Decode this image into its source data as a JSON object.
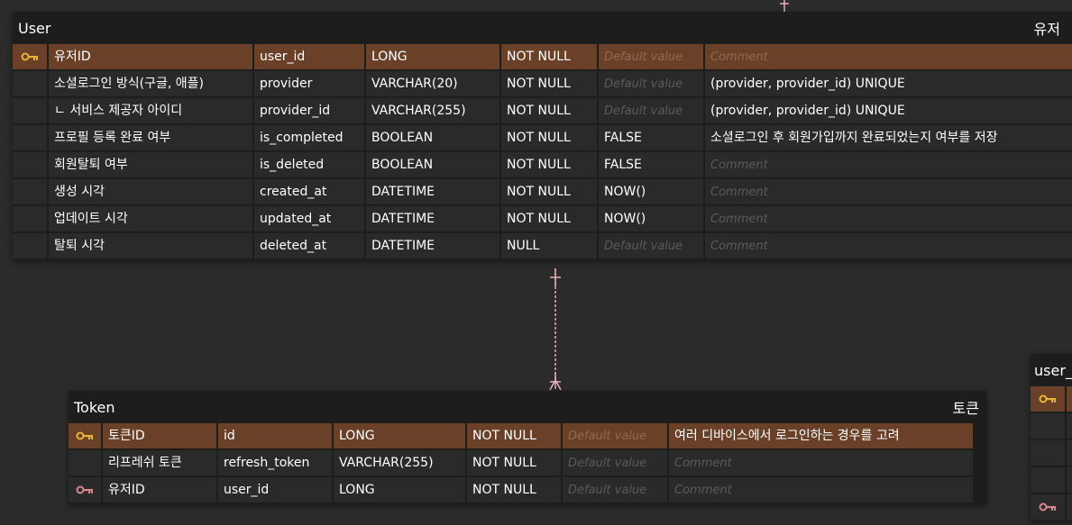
{
  "colors": {
    "canvas": "#2b2b2b",
    "table_bg": "#1d1d1d",
    "cell_bg": "#2a2a2a",
    "pk_row_bg": "#6a4128",
    "pk_key_icon": "#e8b339",
    "fk_key_icon": "#d9868e",
    "relation_line": "#e7b0b8",
    "placeholder_text": "#5a5a5a"
  },
  "user_table": {
    "title": "User",
    "logical_name": "유저",
    "columns": [
      {
        "key": "pk",
        "logical": "유저ID",
        "physical": "user_id",
        "type": "LONG",
        "nullable": "NOT NULL",
        "default": "Default value",
        "comment": "Comment"
      },
      {
        "key": "",
        "logical": "소셜로그인 방식(구글, 애플)",
        "physical": "provider",
        "type": "VARCHAR(20)",
        "nullable": "NOT NULL",
        "default": "Default value",
        "comment": "(provider, provider_id) UNIQUE"
      },
      {
        "key": "",
        "logical": "ㄴ 서비스 제공자 아이디",
        "physical": "provider_id",
        "type": "VARCHAR(255)",
        "nullable": "NOT NULL",
        "default": "Default value",
        "comment": "(provider, provider_id) UNIQUE"
      },
      {
        "key": "",
        "logical": "프로필 등록 완료 여부",
        "physical": "is_completed",
        "type": "BOOLEAN",
        "nullable": "NOT NULL",
        "default": "FALSE",
        "comment": "소셜로그인 후 회원가입까지 완료되었는지 여부를 저장"
      },
      {
        "key": "",
        "logical": "회원탈퇴 여부",
        "physical": "is_deleted",
        "type": "BOOLEAN",
        "nullable": "NOT NULL",
        "default": "FALSE",
        "comment": "Comment"
      },
      {
        "key": "",
        "logical": "생성 시각",
        "physical": "created_at",
        "type": "DATETIME",
        "nullable": "NOT NULL",
        "default": "NOW()",
        "comment": "Comment"
      },
      {
        "key": "",
        "logical": "업데이트 시각",
        "physical": "updated_at",
        "type": "DATETIME",
        "nullable": "NOT NULL",
        "default": "NOW()",
        "comment": "Comment"
      },
      {
        "key": "",
        "logical": "탈퇴 시각",
        "physical": "deleted_at",
        "type": "DATETIME",
        "nullable": "NULL",
        "default": "Default value",
        "comment": "Comment"
      }
    ]
  },
  "token_table": {
    "title": "Token",
    "logical_name": "토큰",
    "columns": [
      {
        "key": "pk",
        "logical": "토큰ID",
        "physical": "id",
        "type": "LONG",
        "nullable": "NOT NULL",
        "default": "Default value",
        "comment": "여러 디바이스에서 로그인하는 경우를 고려"
      },
      {
        "key": "",
        "logical": "리프레쉬 토큰",
        "physical": "refresh_token",
        "type": "VARCHAR(255)",
        "nullable": "NOT NULL",
        "default": "Default value",
        "comment": "Comment"
      },
      {
        "key": "fk",
        "logical": "유저ID",
        "physical": "user_id",
        "type": "LONG",
        "nullable": "NOT NULL",
        "default": "Default value",
        "comment": "Comment"
      }
    ]
  },
  "partial_table": {
    "title": "user_",
    "key_icons": [
      "pk",
      "",
      "",
      "",
      "fk"
    ]
  }
}
